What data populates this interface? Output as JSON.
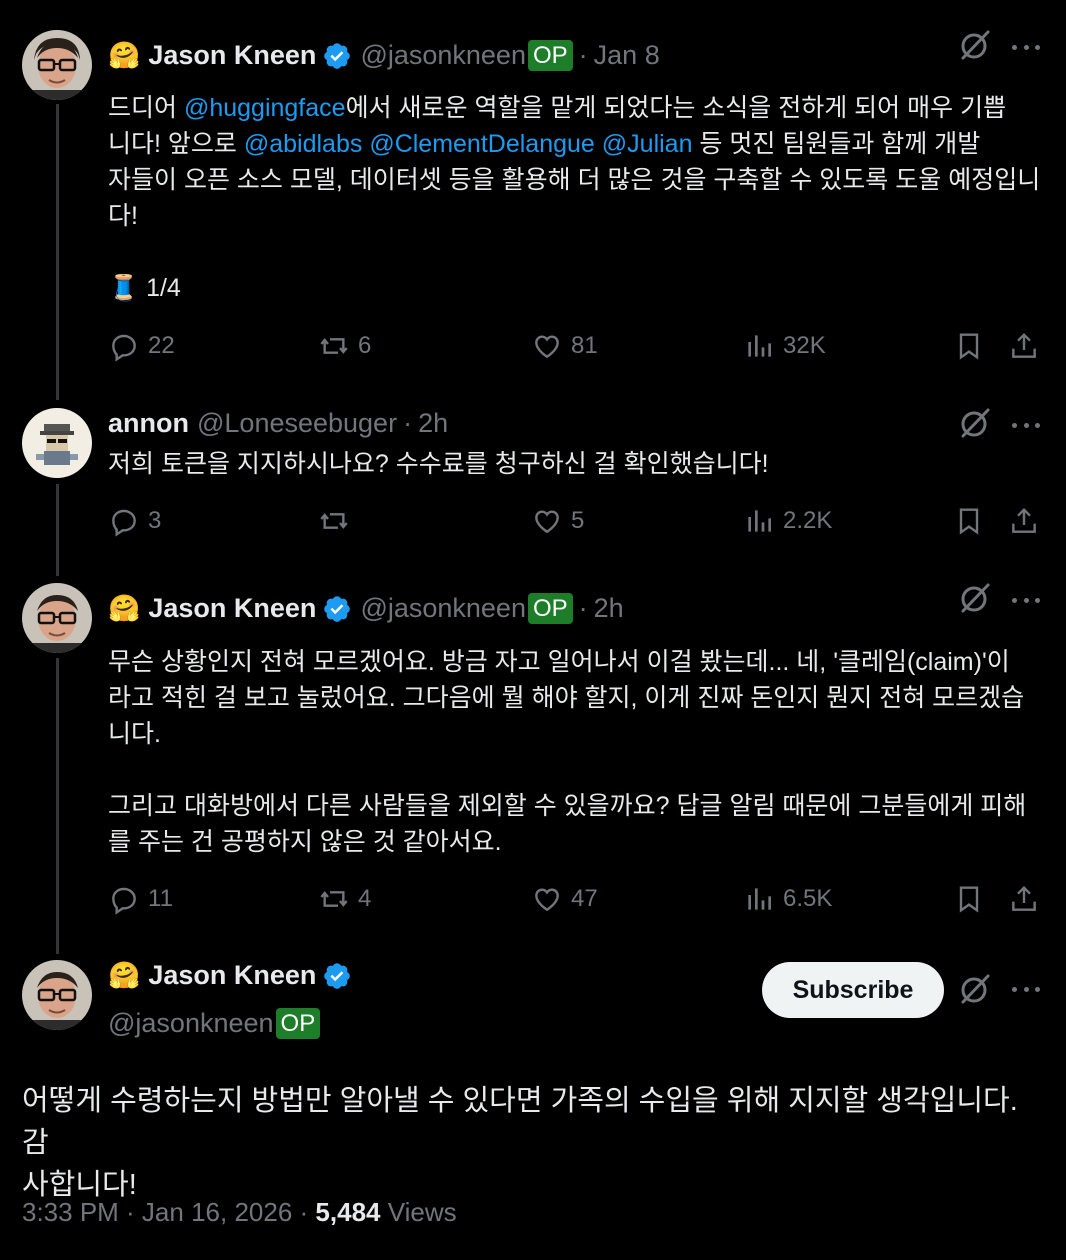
{
  "op_badge": "OP",
  "tweets": [
    {
      "name": "Jason Kneen",
      "handle": "@jasonkneen",
      "time": "Jan 8",
      "body": [
        {
          "t": "드디어 "
        },
        {
          "t": "@huggingface",
          "m": true
        },
        {
          "t": "에서 새로운 역할을 맡게 되었다는 소식을 전하게 되어 매우 기쁩\n니다! 앞으로 "
        },
        {
          "t": "@abidlabs",
          "m": true
        },
        {
          "t": " "
        },
        {
          "t": "@ClementDelangue",
          "m": true
        },
        {
          "t": " "
        },
        {
          "t": "@Julian",
          "m": true
        },
        {
          "t": " 등 멋진 팀원들과 함께 개발\n자들이 오픈 소스 모델, 데이터셋 등을 활용해 더 많은 것을 구축할 수 있도록 도울 예정입니\n다!\n\n🧵 1/4"
        }
      ],
      "stats": {
        "replies": "22",
        "reposts": "6",
        "likes": "81",
        "views": "32K"
      }
    },
    {
      "name": "annon",
      "handle": "@Loneseebuger",
      "time": "2h",
      "body": [
        {
          "t": "저희 토큰을 지지하시나요? 수수료를 청구하신 걸 확인했습니다!"
        }
      ],
      "stats": {
        "replies": "3",
        "reposts": "",
        "likes": "5",
        "views": "2.2K"
      }
    },
    {
      "name": "Jason Kneen",
      "handle": "@jasonkneen",
      "time": "2h",
      "body": [
        {
          "t": "무슨 상황인지 전혀 모르겠어요. 방금 자고 일어나서 이걸 봤는데... 네, '클레임(claim)'이\n라고 적힌 걸 보고 눌렀어요. 그다음에 뭘 해야 할지, 이게 진짜 돈인지 뭔지 전혀 모르겠습\n니다.\n\n그리고 대화방에서 다른 사람들을 제외할 수 있을까요? 답글 알림 때문에 그분들에게 피해\n를 주는 건 공평하지 않은 것 같아서요."
        }
      ],
      "stats": {
        "replies": "11",
        "reposts": "4",
        "likes": "47",
        "views": "6.5K"
      }
    }
  ],
  "main": {
    "name": "Jason Kneen",
    "handle": "@jasonkneen",
    "subscribe_label": "Subscribe",
    "body": "어떻게 수령하는지 방법만 알아낼 수 있다면 가족의 수입을 위해 지지할 생각입니다. 감\n사합니다!",
    "timestamp": "3:33 PM · Jan 16, 2026",
    "views_count": "5,484",
    "views_label": "Views"
  },
  "colors": {
    "accent": "#1d9bf0",
    "op_badge": "#1d7d28",
    "muted": "#71767b"
  }
}
